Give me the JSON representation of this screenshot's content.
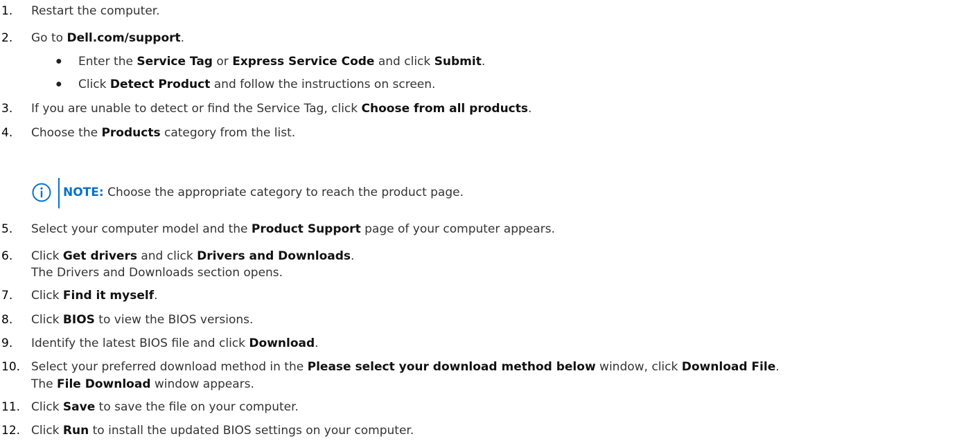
{
  "steps": [
    {
      "n": "1.",
      "parts": [
        {
          "t": "Restart the computer."
        }
      ]
    },
    {
      "n": "2.",
      "parts": [
        {
          "t": "Go to "
        },
        {
          "t": "Dell.com/support",
          "b": true
        },
        {
          "t": "."
        }
      ]
    },
    {
      "n": "3.",
      "parts": [
        {
          "t": "If you are unable to detect or find the Service Tag, click "
        },
        {
          "t": "Choose from all products",
          "b": true
        },
        {
          "t": "."
        }
      ]
    },
    {
      "n": "4.",
      "parts": [
        {
          "t": "Choose the "
        },
        {
          "t": "Products",
          "b": true
        },
        {
          "t": " category from the list."
        }
      ]
    },
    {
      "n": "5.",
      "parts": [
        {
          "t": "Select your computer model and the "
        },
        {
          "t": "Product Support",
          "b": true
        },
        {
          "t": " page of your computer appears."
        }
      ]
    },
    {
      "n": "6.",
      "parts": [
        {
          "t": "Click "
        },
        {
          "t": "Get drivers",
          "b": true
        },
        {
          "t": " and click "
        },
        {
          "t": "Drivers and Downloads",
          "b": true
        },
        {
          "t": "."
        }
      ]
    },
    {
      "n": "7.",
      "parts": [
        {
          "t": "Click "
        },
        {
          "t": "Find it myself",
          "b": true
        },
        {
          "t": "."
        }
      ]
    },
    {
      "n": "8.",
      "parts": [
        {
          "t": "Click "
        },
        {
          "t": "BIOS",
          "b": true
        },
        {
          "t": " to view the BIOS versions."
        }
      ]
    },
    {
      "n": "9.",
      "parts": [
        {
          "t": "Identify the latest BIOS file and click "
        },
        {
          "t": "Download",
          "b": true
        },
        {
          "t": "."
        }
      ]
    },
    {
      "n": "10.",
      "parts": [
        {
          "t": "Select your preferred download method in the "
        },
        {
          "t": "Please select your download method below",
          "b": true
        },
        {
          "t": " window, click "
        },
        {
          "t": "Download File",
          "b": true
        },
        {
          "t": "."
        }
      ]
    },
    {
      "n": "11.",
      "parts": [
        {
          "t": "Click "
        },
        {
          "t": "Save",
          "b": true
        },
        {
          "t": " to save the file on your computer."
        }
      ]
    },
    {
      "n": "12.",
      "parts": [
        {
          "t": "Click "
        },
        {
          "t": "Run",
          "b": true
        },
        {
          "t": " to install the updated BIOS settings on your computer."
        }
      ]
    }
  ],
  "bullets": [
    {
      "parts": [
        {
          "t": "Enter the "
        },
        {
          "t": "Service Tag",
          "b": true
        },
        {
          "t": " or "
        },
        {
          "t": "Express Service Code",
          "b": true
        },
        {
          "t": " and click "
        },
        {
          "t": "Submit",
          "b": true
        },
        {
          "t": "."
        }
      ]
    },
    {
      "parts": [
        {
          "t": "Click "
        },
        {
          "t": "Detect Product",
          "b": true
        },
        {
          "t": " and follow the instructions on screen."
        }
      ]
    }
  ],
  "step6_result": [
    {
      "t": "The Drivers and Downloads section opens."
    }
  ],
  "step10_result": [
    {
      "t": "The "
    },
    {
      "t": "File Download",
      "b": true
    },
    {
      "t": " window appears."
    }
  ],
  "note": {
    "label": "NOTE:",
    "text": " Choose the appropriate category to reach the product page.",
    "icon": "info-icon",
    "accent_color": "#0672cb"
  },
  "bullet_glyph": "●"
}
